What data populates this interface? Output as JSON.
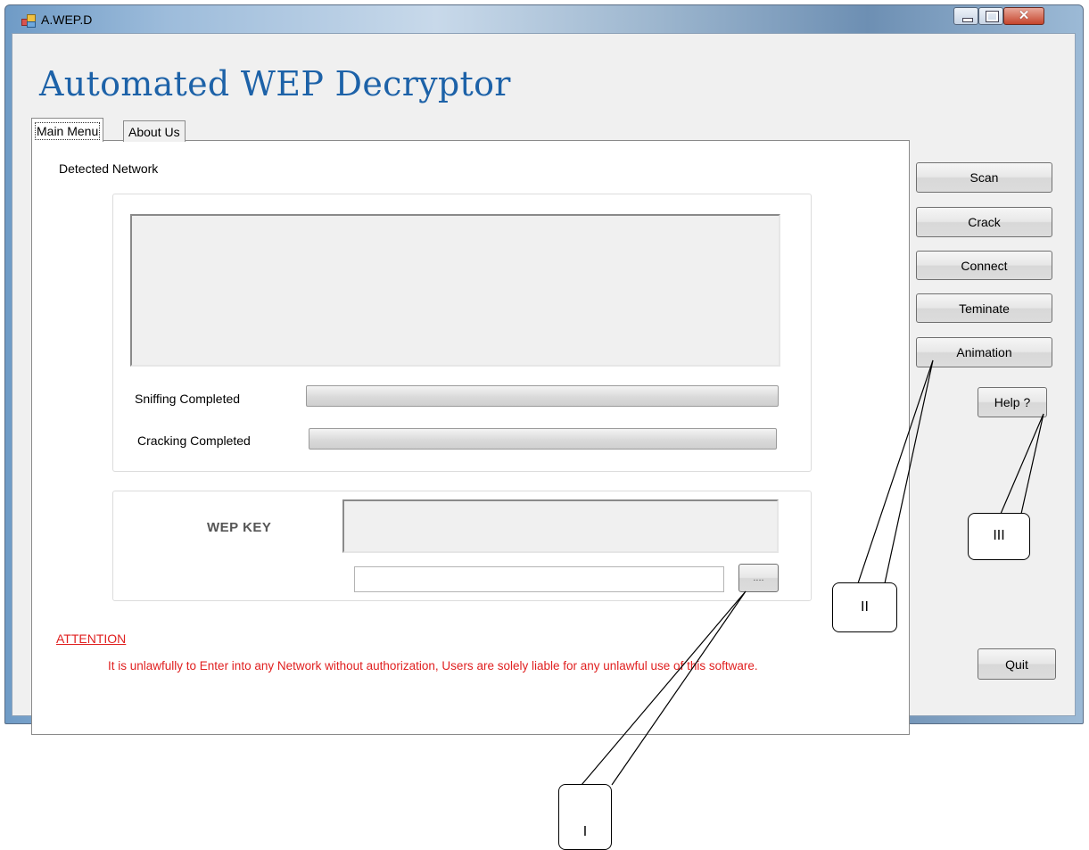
{
  "window": {
    "title": "A.WEP.D"
  },
  "app": {
    "heading": "Automated WEP Decryptor"
  },
  "tabs": [
    {
      "label": "Main Menu",
      "active": true
    },
    {
      "label": "About Us",
      "active": false
    }
  ],
  "main": {
    "detected_network_label": "Detected Network",
    "sniffing_label": "Sniffing Completed",
    "sniffing_progress": 0,
    "cracking_label": "Cracking Completed",
    "cracking_progress": 0,
    "wep_key_label": "WEP KEY",
    "wep_key_value": "",
    "path_value": "",
    "browse_label": "....",
    "attention_label": "ATTENTION",
    "warning_text": "It is unlawfully to Enter into any Network without authorization, Users are solely liable for any unlawful use of this software."
  },
  "buttons": {
    "scan": "Scan",
    "crack": "Crack",
    "connect": "Connect",
    "terminate": "Teminate",
    "animation": "Animation",
    "help": "Help ?",
    "quit": "Quit"
  },
  "callouts": {
    "one": "I",
    "two": "II",
    "three": "III"
  },
  "colors": {
    "heading": "#1d62a8",
    "warning": "#e02020"
  }
}
